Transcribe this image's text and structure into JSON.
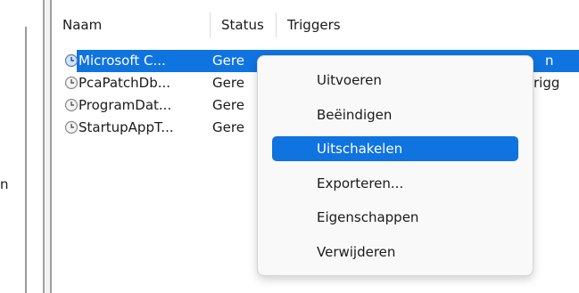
{
  "left_pane": {
    "partial_label": "n"
  },
  "columns": {
    "name": "Naam",
    "status": "Status",
    "triggers": "Triggers"
  },
  "rows": [
    {
      "name": "Microsoft C...",
      "status": "Gere",
      "trigger": "",
      "selected": true,
      "trigger_tail": "n"
    },
    {
      "name": "PcaPatchDb...",
      "status": "Gere",
      "trigger": "",
      "selected": false,
      "trigger_tail": "rigg"
    },
    {
      "name": "ProgramDat...",
      "status": "Gere",
      "trigger": "",
      "selected": false
    },
    {
      "name": "StartupAppT...",
      "status": "Gere",
      "trigger": "",
      "selected": false
    }
  ],
  "context_menu": {
    "items": [
      {
        "label": "Uitvoeren"
      },
      {
        "label": "Beëindigen"
      },
      {
        "label": "Uitschakelen",
        "highlighted": true
      },
      {
        "label": "Exporteren..."
      },
      {
        "label": "Eigenschappen"
      },
      {
        "label": "Verwijderen"
      }
    ]
  },
  "colors": {
    "selection": "#0f73e0",
    "task_icon": "#8a8a8a"
  },
  "icons": {
    "task": "clock-task-icon"
  }
}
